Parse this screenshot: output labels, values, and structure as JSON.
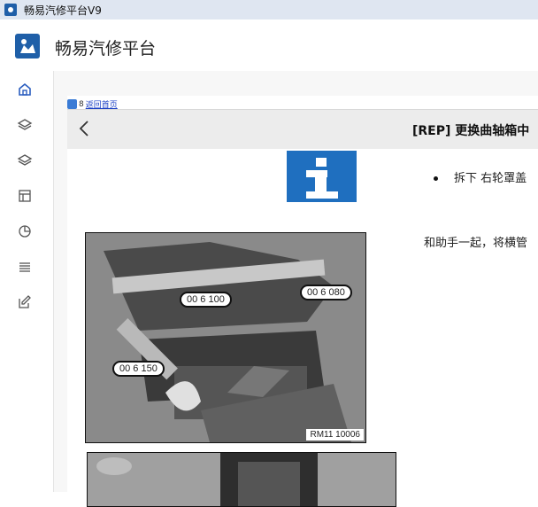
{
  "window": {
    "title": "畅易汽修平台V9"
  },
  "header": {
    "brand": "畅易汽修平台"
  },
  "sidebar": {
    "items": [
      {
        "icon": "home-icon"
      },
      {
        "icon": "layers-icon"
      },
      {
        "icon": "layers-icon"
      },
      {
        "icon": "layout-icon"
      },
      {
        "icon": "pie-chart-icon"
      },
      {
        "icon": "list-icon"
      },
      {
        "icon": "edit-icon"
      }
    ]
  },
  "doc": {
    "back_num": "8",
    "back_link": "返回首页",
    "title": "[REP] 更换曲轴箱中",
    "bullet": "拆下 右轮罩盖",
    "paragraph": "和助手一起，将横管",
    "figure": {
      "callouts": [
        "00 6 100",
        "00 6 080",
        "00 6 150"
      ],
      "code": "RM11 10006"
    }
  }
}
